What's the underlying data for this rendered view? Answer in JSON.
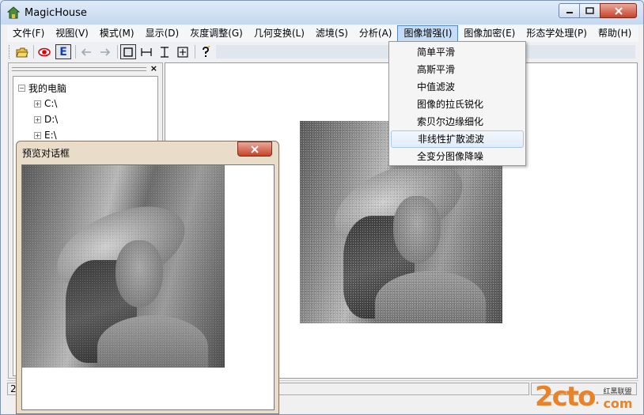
{
  "window": {
    "title": "MagicHouse"
  },
  "menubar": {
    "items": [
      {
        "label": "文件(F)"
      },
      {
        "label": "视图(V)"
      },
      {
        "label": "模式(M)"
      },
      {
        "label": "显示(D)"
      },
      {
        "label": "灰度调整(G)"
      },
      {
        "label": "几何变换(L)"
      },
      {
        "label": "滤境(S)"
      },
      {
        "label": "分析(A)"
      },
      {
        "label": "图像增强(I)",
        "active": true
      },
      {
        "label": "图像加密(E)"
      },
      {
        "label": "形态学处理(P)"
      },
      {
        "label": "帮助(H)"
      }
    ]
  },
  "toolbar": {
    "buttons": [
      {
        "icon": "open-folder-icon"
      },
      {
        "icon": "eye-icon"
      },
      {
        "icon": "letter-e-icon",
        "glyph": "E"
      },
      {
        "icon": "arrow-left-icon"
      },
      {
        "icon": "arrow-right-icon"
      },
      {
        "icon": "rectangle-select-icon"
      },
      {
        "icon": "horizontal-measure-icon"
      },
      {
        "icon": "vertical-measure-icon"
      },
      {
        "icon": "crosshair-box-icon"
      },
      {
        "icon": "help-icon"
      }
    ]
  },
  "tree": {
    "root": "我的电脑",
    "drives": [
      "C:\\",
      "D:\\",
      "E:\\"
    ]
  },
  "status": {
    "left": "2"
  },
  "dropdown": {
    "items": [
      "简单平滑",
      "高斯平滑",
      "中值滤波",
      "图像的拉氏锐化",
      "索贝尔边缘细化",
      "非线性扩散滤波",
      "全变分图像降噪"
    ],
    "hover_index": 5
  },
  "dialog": {
    "title": "预览对话框"
  },
  "watermark": {
    "main": "2cto",
    "dot": ".",
    "com": "com",
    "cn": "红黑联盟"
  },
  "colors": {
    "accent": "#e8832a",
    "close_red": "#c8432b",
    "menu_highlight": "#c6dcf4"
  }
}
